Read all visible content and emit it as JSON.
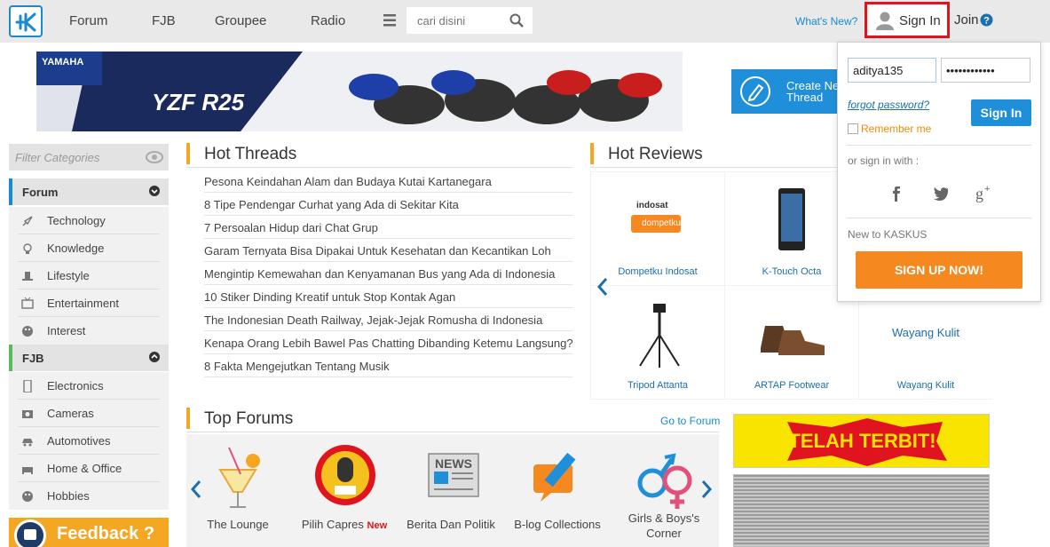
{
  "header": {
    "nav": [
      "Forum",
      "FJB",
      "Groupee",
      "Radio"
    ],
    "search_placeholder": "cari disini",
    "whats_new": "What's New?",
    "sign_in": "Sign In",
    "join": "Join"
  },
  "create_thread": {
    "line1": "Create Ne",
    "line2": "Thread"
  },
  "sidebar": {
    "filter_placeholder": "Filter Categories",
    "forum_label": "Forum",
    "forum_items": [
      "Technology",
      "Knowledge",
      "Lifestyle",
      "Entertainment",
      "Interest"
    ],
    "fjb_label": "FJB",
    "fjb_items": [
      "Electronics",
      "Cameras",
      "Automotives",
      "Home & Office",
      "Hobbies"
    ],
    "feedback": "Feedback ?"
  },
  "hot_threads": {
    "title": "Hot Threads",
    "items": [
      "Pesona Keindahan Alam dan Budaya Kutai Kartanegara",
      "8 Tipe Pendengar Curhat yang Ada di Sekitar Kita",
      "7 Persoalan Hidup dari Chat Grup",
      "Garam Ternyata Bisa Dipakai Untuk Kesehatan dan Kecantikan Loh",
      "Mengintip Kemewahan dan Kenyamanan Bus yang Ada di Indonesia",
      "10 Stiker Dinding Kreatif untuk Stop Kontak Agan",
      "The Indonesian Death Railway, Jejak-Jejak Romusha di Indonesia",
      "Kenapa Orang Lebih Bawel Pas Chatting Dibanding Ketemu Langsung?",
      "8 Fakta Mengejutkan Tentang Musik"
    ]
  },
  "hot_reviews": {
    "title": "Hot Reviews",
    "items": [
      "Dompetku Indosat",
      "K-Touch Octa",
      "Tripod Attanta",
      "ARTAP Footwear",
      "Wayang Kulit"
    ],
    "wayang_image_text": "Wayang Kulit",
    "indosat_text": "indosat",
    "dompetku_text": "dompetku"
  },
  "top_forums": {
    "title": "Top Forums",
    "goto": "Go to Forum",
    "items": [
      "The Lounge",
      "Pilih Capres",
      "Berita Dan Politik",
      "B-log Collections",
      "Girls & Boys's",
      "Corner"
    ],
    "new_tag": "New",
    "news_text": "NEWS"
  },
  "ads": {
    "yellow_text": "TELAH TERBIT!"
  },
  "banner": {
    "brand": "YAMAHA",
    "model": "YZF R25"
  },
  "signin_dropdown": {
    "username": "aditya135",
    "password": "••••••••••••",
    "forgot": "forgot password?",
    "signin_button": "Sign In",
    "remember": "Remember me",
    "or_sign_in": "or sign in with :",
    "new_to": "New to KASKUS",
    "signup": "SIGN UP NOW!"
  },
  "colors": {
    "accent_blue": "#1f8fd9",
    "orange": "#f5891f",
    "highlight_red": "#e0141e"
  }
}
